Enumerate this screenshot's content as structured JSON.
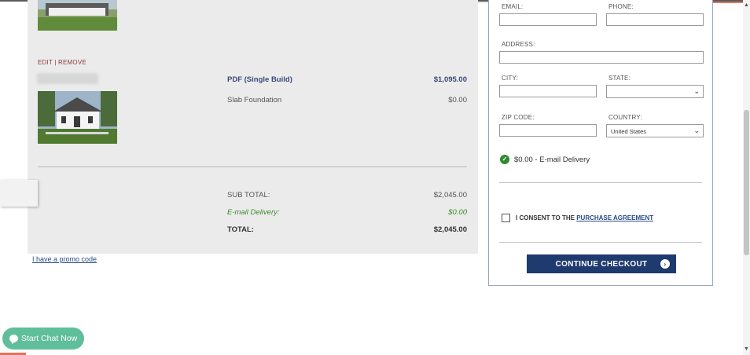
{
  "cart": {
    "edit_label": "EDIT",
    "separator": "|",
    "remove_label": "REMOVE",
    "items": [
      {
        "name": "PDF (Single Build)",
        "price": "$1,095.00"
      },
      {
        "name": "Slab Foundation",
        "price": "$0.00"
      }
    ],
    "totals": {
      "subtotal_label": "SUB TOTAL:",
      "subtotal_value": "$2,045.00",
      "delivery_label": "E-mail Delivery:",
      "delivery_value": "$0.00",
      "total_label": "TOTAL:",
      "total_value": "$2,045.00"
    },
    "promo_link": "I have a promo code"
  },
  "form": {
    "email_label": "EMAIL:",
    "phone_label": "PHONE:",
    "address_label": "ADDRESS:",
    "city_label": "CITY:",
    "state_label": "STATE:",
    "state_value": "",
    "zip_label": "ZIP CODE:",
    "country_label": "COUNTRY:",
    "country_value": "United States",
    "delivery_text": "$0.00 - E-mail Delivery",
    "consent_text": "I CONSENT TO THE",
    "consent_link": "PURCHASE AGREEMENT",
    "continue_label": "CONTINUE CHECKOUT"
  },
  "chat": {
    "label": "Start Chat Now"
  },
  "colors": {
    "accent": "#1f3a6e",
    "chat": "#5fbf9a",
    "success": "#2e8b2e",
    "link": "#2a4a8a",
    "orange_bar": "#e0745f"
  },
  "icons": {
    "check": "check-circle-icon",
    "arrow": "arrow-right-circle-icon",
    "chevron": "chevron-down-icon",
    "chat": "chat-bubble-icon"
  }
}
